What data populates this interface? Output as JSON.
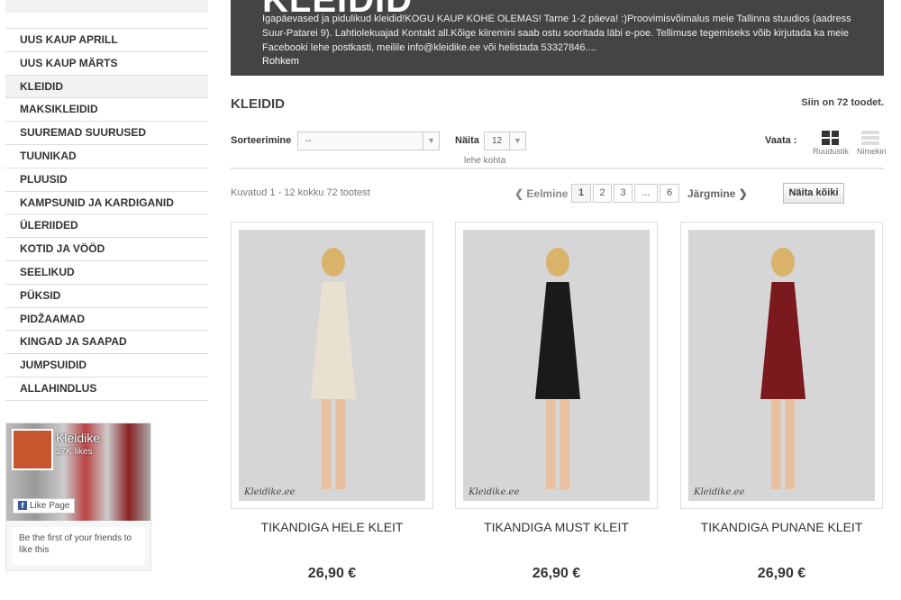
{
  "sidebar": {
    "items": [
      "UUS KAUP APRILL",
      "UUS KAUP MÄRTS",
      "KLEIDID",
      "MAKSIKLEIDID",
      "SUUREMAD SUURUSED",
      "TUUNIKAD",
      "PLUUSID",
      "KAMPSUNID JA KARDIGANID",
      "ÜLERIIDED",
      "KOTID JA VÖÖD",
      "SEELIKUD",
      "PÜKSID",
      "PIDŽAAMAD",
      "KINGAD JA SAAPAD",
      "JUMPSUIDID",
      "ALLAHINDLUS"
    ],
    "active": "KLEIDID"
  },
  "facebook": {
    "name": "Kleidike",
    "likes": "17K likes",
    "like_button": "Like Page",
    "friends_text": "Be the first of your friends to like this"
  },
  "hero": {
    "title": "KLEIDID",
    "description": "Igapäevased ja pidulikud kleidid!KOGU KAUP KOHE OLEMAS! Tarne 1-2 päeva! :)Proovimisvõimalus meie Tallinna stuudios (aadress Suur-Patarei 9). Lahtiolekuajad Kontakt all.Kõige kiiremini saab ostu sooritada läbi e-poe. Tellimuse tegemiseks võib kirjutada ka meie Facebooki lehe postkasti, meilile info@kleidike.ee või helistada 53327846....",
    "more": "Rohkem"
  },
  "category": {
    "title": "KLEIDID",
    "count": "Siin on 72 toodet."
  },
  "toolbar": {
    "sort_label": "Sorteerimine",
    "sort_value": "--",
    "show_label": "Näita",
    "show_value": "12",
    "per_page": "lehe kohta",
    "view_label": "Vaata :",
    "grid": "Ruudustik",
    "list": "Nimekiri"
  },
  "pagination": {
    "summary": "Kuvatud 1 - 12 kokku 72 tootest",
    "prev": "Eelmine",
    "pages": [
      "1",
      "2",
      "3",
      "...",
      "6"
    ],
    "current": "1",
    "next": "Järgmine",
    "show_all": "Näita kõiki"
  },
  "products": [
    {
      "name": "TIKANDIGA HELE KLEIT",
      "price": "26,90 €",
      "watermark": "Kleidike.ee",
      "color": "#e8e0d0"
    },
    {
      "name": "TIKANDIGA MUST KLEIT",
      "price": "26,90 €",
      "watermark": "Kleidike.ee",
      "color": "#1a1a1a"
    },
    {
      "name": "TIKANDIGA PUNANE KLEIT",
      "price": "26,90 €",
      "watermark": "Kleidike.ee",
      "color": "#7a1a1e"
    }
  ]
}
